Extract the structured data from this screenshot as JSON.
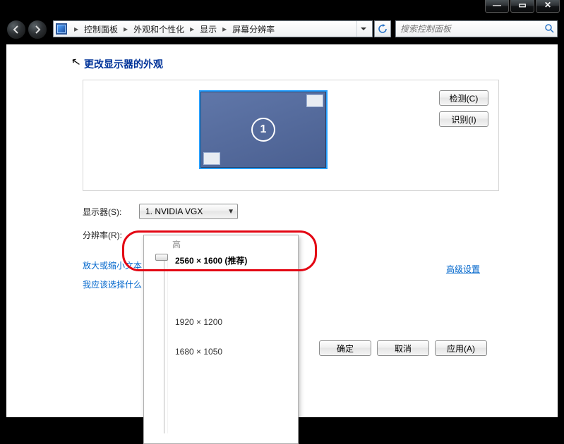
{
  "titlebar": {
    "min": "—",
    "max": "▭",
    "close": "✕"
  },
  "nav": {
    "segments": [
      "控制面板",
      "外观和个性化",
      "显示",
      "屏幕分辨率"
    ],
    "search_placeholder": "搜索控制面板"
  },
  "page": {
    "title": "更改显示器的外观",
    "monitor_number": "1",
    "detect": "检测(C)",
    "identify": "识别(I)",
    "display_label": "显示器(S):",
    "display_value": "1. NVIDIA VGX",
    "resolution_label": "分辨率(R):",
    "advanced": "高级设置",
    "link_scale": "放大或缩小文本",
    "link_whatchoose": "我应该选择什么",
    "ok": "确定",
    "cancel": "取消",
    "apply": "应用(A)"
  },
  "res_dropdown": {
    "high": "高",
    "options": [
      "2560 × 1600 (推荐)",
      "1920 × 1200",
      "1680 × 1050"
    ]
  }
}
